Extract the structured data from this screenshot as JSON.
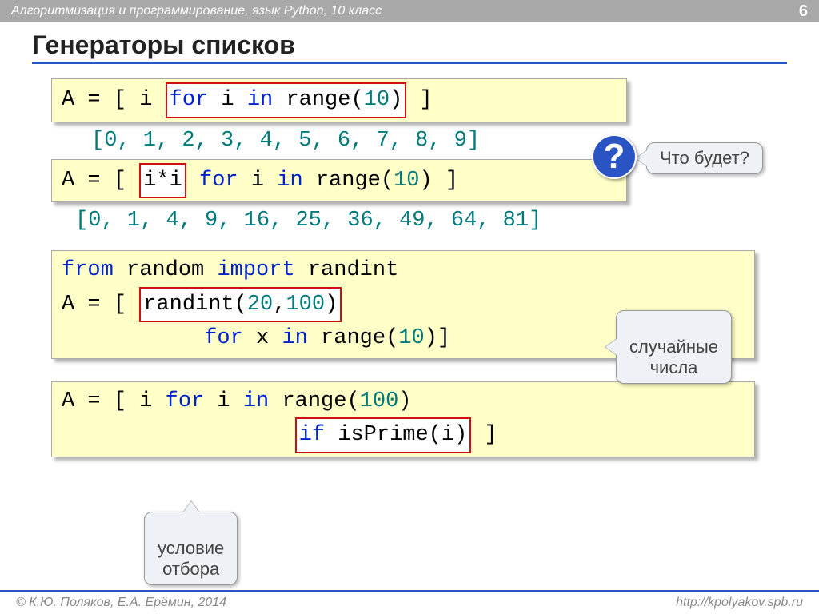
{
  "header": {
    "subject": "Алгоритмизация и программирование, язык Python, 10 класс",
    "pagenum": "6"
  },
  "title": "Генераторы списков",
  "code1": {
    "pre": "A = [ i ",
    "hl": "for i in range(10)",
    "post": " ]"
  },
  "output1": "[0, 1, 2, 3, 4, 5, 6, 7, 8, 9]",
  "qlabel": "Что будет?",
  "code2": {
    "pre": "A = [ ",
    "hl": "i*i",
    "mid": "  ",
    "kw": "for i in range(10)",
    "post": " ]"
  },
  "output2": "[0, 1, 4, 9, 16, 25, 36, 49, 64, 81]",
  "code3": {
    "line1a": "from ",
    "line1b": "random ",
    "line1c": "import ",
    "line1d": "randint",
    "line2a": "A = [ ",
    "line2hl_a": "randint(",
    "line2hl_b": "20",
    "line2hl_c": ",",
    "line2hl_d": "100",
    "line2hl_e": ")",
    "line3": "           for x in range(10)]"
  },
  "callout_random": "случайные\nчисла",
  "code4": {
    "line1": "A = [ i for i in range(100)",
    "line2pre": "         ",
    "line2hl": "if isPrime(i)",
    "line2post": " ]"
  },
  "callout_filter": "условие\nотбора",
  "footer": {
    "copyright": "© К.Ю. Поляков, Е.А. Ерёмин, 2014",
    "url": "http://kpolyakov.spb.ru"
  }
}
